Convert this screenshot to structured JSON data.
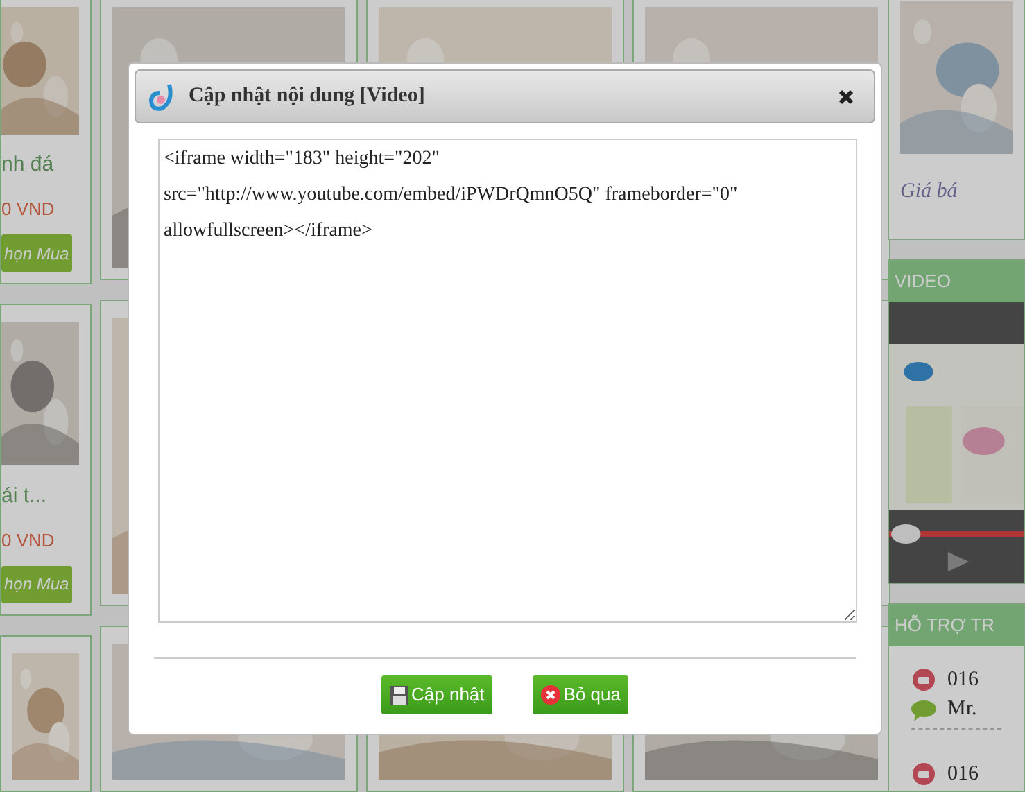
{
  "products": [
    {
      "name": "nh đá",
      "price": "0 VND",
      "button": "họn Mua"
    },
    {
      "name": "ái t...",
      "price": "0 VND",
      "button": "họn Mua"
    }
  ],
  "sidebar": {
    "price_label": "Giá bá",
    "video": {
      "title": "VIDEO"
    },
    "support": {
      "title": "HỖ TRỢ TR",
      "contacts": [
        {
          "kind": "phone",
          "text": "016"
        },
        {
          "kind": "chat",
          "text": "Mr."
        },
        {
          "kind": "phone",
          "text": "016"
        }
      ]
    }
  },
  "dialog": {
    "title": "Cập nhật nội dung [Video]",
    "content": "<iframe width=\"183\" height=\"202\" src=\"http://www.youtube.com/embed/iPWDrQmnO5Q\" frameborder=\"0\" allowfullscreen></iframe>",
    "buttons": [
      {
        "kind": "save",
        "label": "Cập nhật"
      },
      {
        "kind": "cancel",
        "label": "Bỏ qua"
      }
    ]
  }
}
